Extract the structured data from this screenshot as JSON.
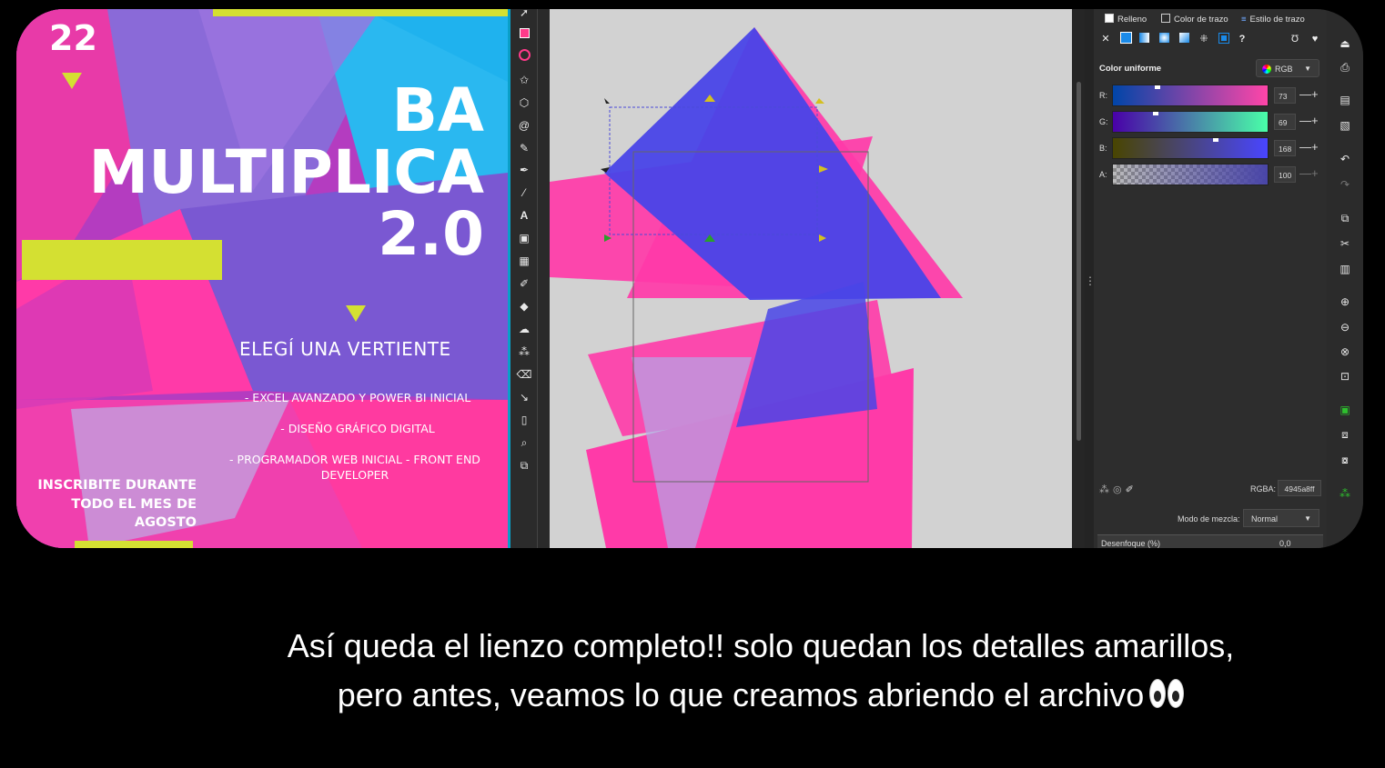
{
  "poster": {
    "year": "22",
    "title_lines": [
      "BA",
      "MULTIPLICA",
      "2.0"
    ],
    "subtitle": "ELEGÍ UNA VERTIENTE",
    "items": [
      "- EXCEL AVANZADO Y POWER BI INICIAL",
      "- DISEÑO GRÁFICO DIGITAL",
      "- PROGRAMADOR WEB INICIAL - FRONT END DEVELOPER"
    ],
    "cta": "INSCRIBITE DURANTE TODO EL MES DE AGOSTO",
    "colors": {
      "magenta": "#ff3aa8",
      "violet": "#7a5ad6",
      "cyan": "#22b4ee",
      "lime": "#d4e032"
    }
  },
  "toolbox": {
    "tools": [
      "selector-icon",
      "rectangle-icon",
      "ellipse-icon",
      "star-icon",
      "3d-box-icon",
      "spiral-icon",
      "pencil-icon",
      "pen-icon",
      "calligraphy-icon",
      "text-icon",
      "gradient-icon",
      "mesh-icon",
      "dropper-icon",
      "paint-bucket-icon",
      "tweak-icon",
      "spray-icon",
      "eraser-icon",
      "connector-icon",
      "pages-icon",
      "zoom-icon",
      "measure-icon"
    ]
  },
  "fill_panel": {
    "tabs": {
      "fill": "Relleno",
      "stroke_paint": "Color de trazo",
      "stroke_style": "Estilo de trazo"
    },
    "uniform_label": "Color uniforme",
    "color_model": "RGB",
    "channels": [
      {
        "label": "R:",
        "value": "73"
      },
      {
        "label": "G:",
        "value": "69"
      },
      {
        "label": "B:",
        "value": "168"
      },
      {
        "label": "A:",
        "value": "100"
      }
    ],
    "rgba_label": "RGBA:",
    "rgba_value": "4945a8ff",
    "blend_label": "Modo de mezcla:",
    "blend_value": "Normal",
    "blur_label": "Desenfoque (%)",
    "blur_value": "0,0",
    "accent_color": "#4945a8"
  },
  "commands": [
    "open-icon",
    "print-icon",
    "import-icon",
    "export-icon",
    "undo-icon",
    "redo-icon",
    "copy-icon",
    "cut-icon",
    "paste-icon",
    "zoom-selection-icon",
    "zoom-drawing-icon",
    "zoom-page-icon",
    "zoom-fit-icon",
    "duplicate-icon",
    "clone-icon",
    "unlink-clone-icon",
    "group-icon"
  ],
  "caption": {
    "line1": "Así queda el lienzo completo!! solo quedan los detalles amarillos,",
    "line2": "pero antes, veamos lo que creamos abriendo el archivo",
    "emoji": "eyes-emoji"
  }
}
